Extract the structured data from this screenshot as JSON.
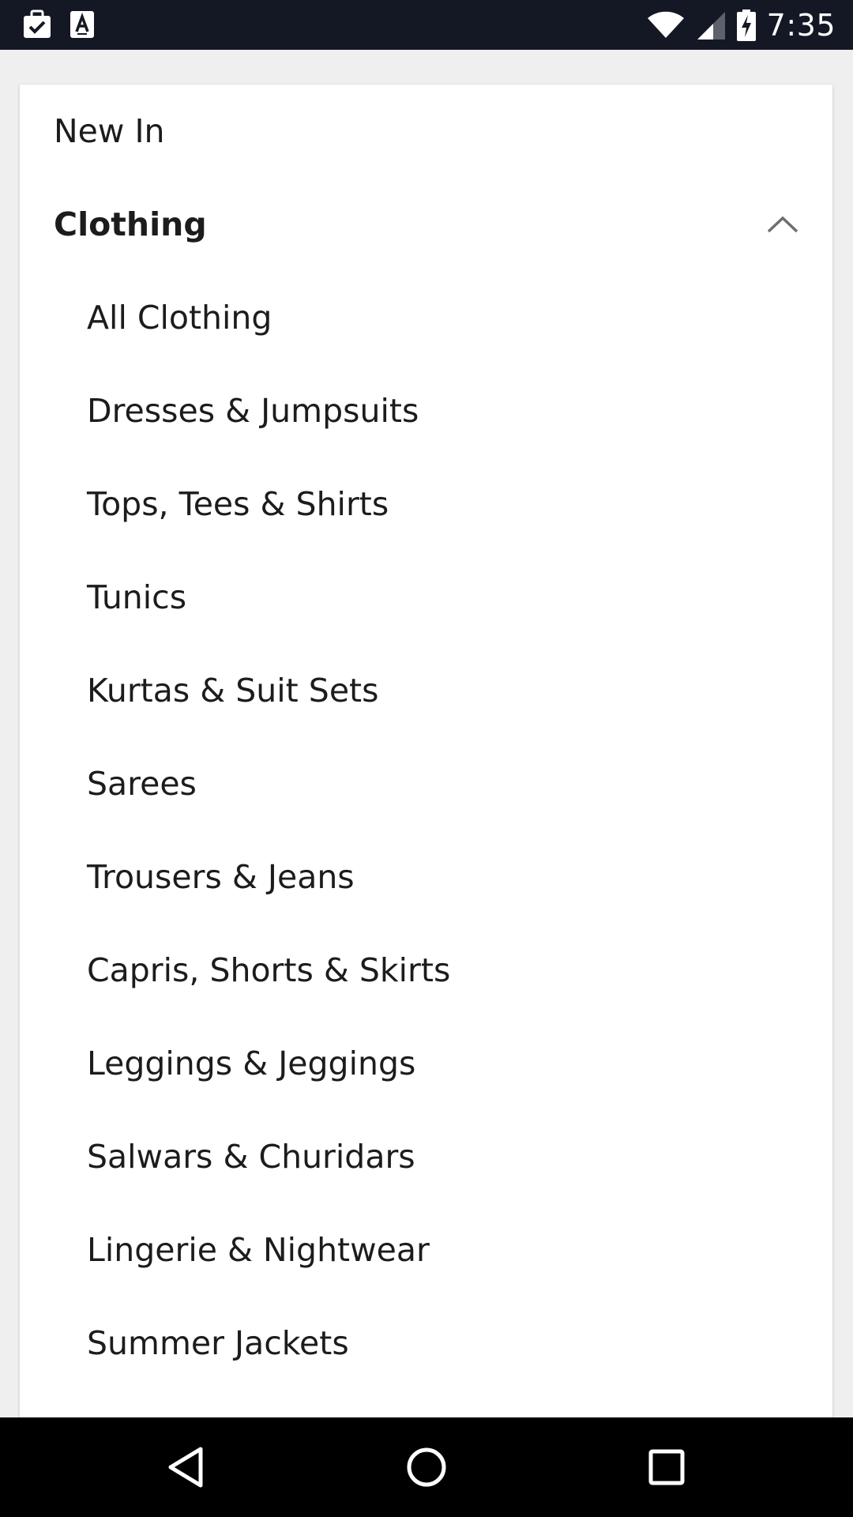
{
  "status_bar": {
    "time": "7:35",
    "left_icons": [
      "briefcase-check-icon",
      "text-a-icon"
    ],
    "right_icons": [
      "wifi-icon",
      "cell-signal-icon",
      "battery-charging-icon"
    ]
  },
  "menu": {
    "new_in": "New In",
    "section": {
      "label": "Clothing",
      "expanded": true,
      "icon": "chevron-up-icon"
    },
    "items": [
      "All Clothing",
      "Dresses & Jumpsuits",
      "Tops, Tees & Shirts",
      "Tunics",
      "Kurtas & Suit Sets",
      "Sarees",
      "Trousers & Jeans",
      "Capris, Shorts & Skirts",
      "Leggings & Jeggings",
      "Salwars & Churidars",
      "Lingerie & Nightwear",
      "Summer Jackets"
    ]
  },
  "nav_bar": {
    "buttons": [
      "back-icon",
      "home-icon",
      "recents-icon"
    ]
  },
  "colors": {
    "status_bar_bg": "#141824",
    "page_bg": "#efefef",
    "card_bg": "#ffffff",
    "text": "#1c1c1c",
    "nav_bar_bg": "#000000"
  }
}
